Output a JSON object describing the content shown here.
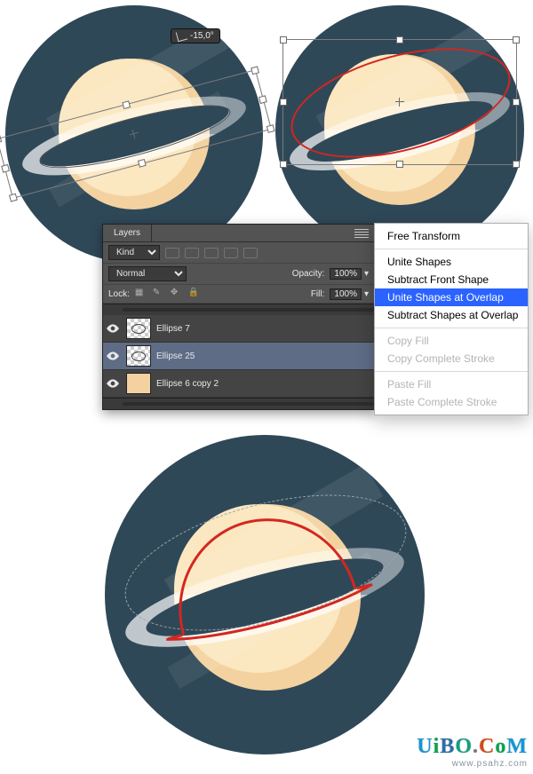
{
  "angle_tooltip": "-15,0°",
  "angle_icon": "angle",
  "layers_panel": {
    "tab": "Layers",
    "kind_label": "Kind",
    "blend_mode": "Normal",
    "opacity_label": "Opacity:",
    "opacity_value": "100%",
    "lock_label": "Lock:",
    "fill_label": "Fill:",
    "fill_value": "100%",
    "items": [
      {
        "name": "Ellipse 7"
      },
      {
        "name": "Ellipse 25"
      },
      {
        "name": "Ellipse 6 copy 2"
      }
    ]
  },
  "context_menu": {
    "items": [
      {
        "label": "Free Transform",
        "state": "normal",
        "sep_after": true
      },
      {
        "label": "Unite Shapes",
        "state": "normal"
      },
      {
        "label": "Subtract Front Shape",
        "state": "normal"
      },
      {
        "label": "Unite Shapes at Overlap",
        "state": "selected"
      },
      {
        "label": "Subtract Shapes at Overlap",
        "state": "normal",
        "sep_after": true
      },
      {
        "label": "Copy Fill",
        "state": "disabled"
      },
      {
        "label": "Copy Complete Stroke",
        "state": "disabled",
        "sep_after": true
      },
      {
        "label": "Paste Fill",
        "state": "disabled"
      },
      {
        "label": "Paste Complete Stroke",
        "state": "disabled"
      }
    ]
  },
  "watermark": {
    "main": "UiBO.CoM",
    "sub": "www.psahz.com"
  }
}
